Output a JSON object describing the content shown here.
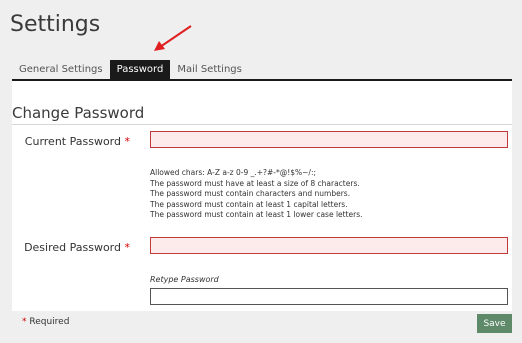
{
  "page": {
    "title": "Settings"
  },
  "tabs": [
    {
      "label": "General Settings",
      "active": false
    },
    {
      "label": "Password",
      "active": true
    },
    {
      "label": "Mail Settings",
      "active": false
    }
  ],
  "section": {
    "title": "Change Password"
  },
  "form": {
    "current_label": "Current Password",
    "current_value": "",
    "desired_label": "Desired Password",
    "desired_value": "",
    "required_marker": "*",
    "retype_label": "Retype Password",
    "retype_value": "",
    "rules": [
      "Allowed chars: A-Z a-z 0-9 _.+?#-*@!$%~/:;",
      "The password must have at least a size of 8 characters.",
      "The password must contain characters and numbers.",
      "The password must contain at least 1 capital letters.",
      "The password must contain at least 1 lower case letters."
    ]
  },
  "footer": {
    "required_marker": "*",
    "required_text": "Required",
    "save_label": "Save"
  },
  "colors": {
    "error_border": "#c0393b",
    "error_fill": "#fdeaea",
    "active_tab": "#1a1a1a",
    "save_button": "#5e8a6a",
    "arrow": "#e02020"
  },
  "icons": {
    "annotation": "red-arrow-icon"
  }
}
